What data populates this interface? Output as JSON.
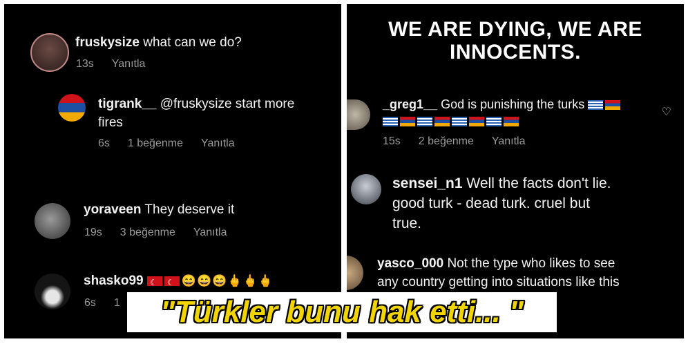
{
  "left": {
    "c1": {
      "user": "fruskysize",
      "text": "what can we do?",
      "time": "13s",
      "reply": "Yanıtla"
    },
    "c2": {
      "user": "tigrank__",
      "text_line1": "@fruskysize start more",
      "text_line2": "fires",
      "time": "6s",
      "likes": "1 beğenme",
      "reply": "Yanıtla"
    },
    "c3": {
      "user": "yoraveen",
      "text": "They deserve it",
      "time": "19s",
      "likes": "3 beğenme",
      "reply": "Yanıtla"
    },
    "c4": {
      "user": "shasko99",
      "time": "6s",
      "likes_partial": "1",
      "emojis": [
        "flag-turkey",
        "flag-turkey",
        "grinning-face",
        "grinning-face",
        "grinning-face",
        "middle-finger",
        "middle-finger",
        "middle-finger"
      ]
    }
  },
  "right": {
    "headline_line1": "WE ARE DYING, WE ARE",
    "headline_line2": "INNOCENTS.",
    "c1": {
      "user": "_greg1__",
      "text": "God is punishing the turks",
      "time": "15s",
      "likes": "2 beğenme",
      "reply": "Yanıtla",
      "flags": [
        "flag-greece",
        "flag-armenia"
      ]
    },
    "c2": {
      "user": "sensei_n1",
      "text_line1": "Well the facts don't lie.",
      "text_line2": "good turk - dead turk.  cruel but",
      "text_line3": "true."
    },
    "c3": {
      "user": "yasco_000",
      "text_line1": "Not the type who likes to see",
      "text_line2": "any country getting into situations like this"
    }
  },
  "banner": {
    "text": "\"Türkler bunu hak etti... \""
  },
  "icons": {
    "heart": "heart-icon"
  },
  "colors": {
    "panel_bg": "#000000",
    "banner_text": "#f2d400",
    "meta_text": "#9a9a9a"
  }
}
